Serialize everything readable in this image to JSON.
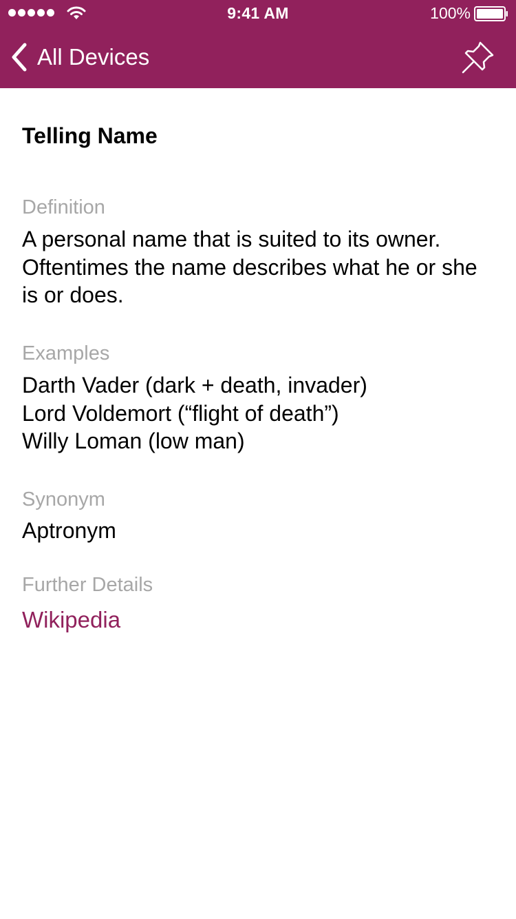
{
  "status_bar": {
    "time": "9:41 AM",
    "battery_percent": "100%",
    "signal_bars": 5,
    "icons": [
      "signal-dots-icon",
      "wifi-icon",
      "battery-icon"
    ]
  },
  "nav": {
    "back_label": "All Devices",
    "back_icon": "chevron-left-icon",
    "pin_icon": "pushpin-icon"
  },
  "colors": {
    "accent": "#91215c",
    "label_gray": "#a7a7a7",
    "text": "#000000",
    "background": "#ffffff"
  },
  "term": {
    "title": "Telling Name",
    "definition_label": "Definition",
    "definition": "A personal name that is suited to its owner. Oftentimes the name describes what he or she is or does.",
    "examples_label": "Examples",
    "examples": [
      "Darth Vader (dark + death, invader)",
      "Lord Voldemort (“flight of death”)",
      "Willy Loman (low man)"
    ],
    "synonym_label": "Synonym",
    "synonym": "Aptronym",
    "further_label": "Further Details",
    "further_link": "Wikipedia"
  }
}
